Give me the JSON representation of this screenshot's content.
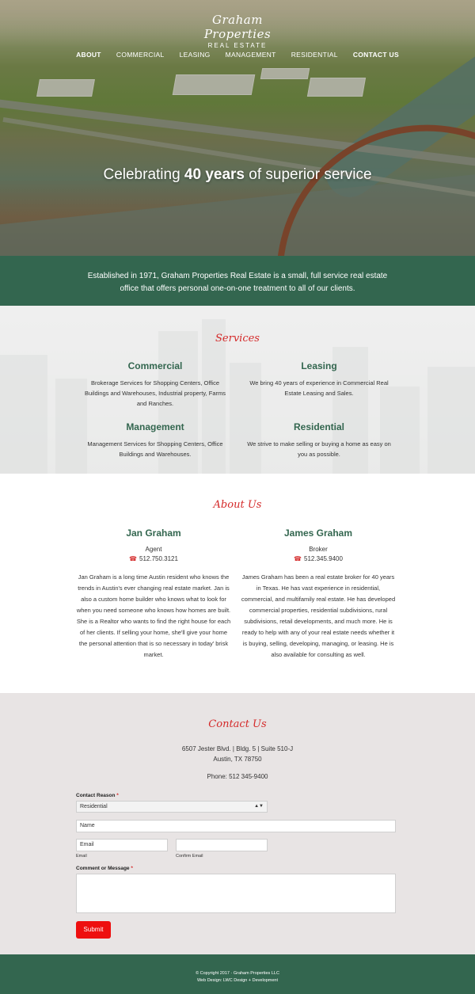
{
  "brand": {
    "logo_script": "Graham Properties",
    "logo_sub": "REAL ESTATE"
  },
  "nav": [
    {
      "label": "ABOUT",
      "bold": true
    },
    {
      "label": "COMMERCIAL",
      "bold": false
    },
    {
      "label": "LEASING",
      "bold": false
    },
    {
      "label": "MANAGEMENT",
      "bold": false
    },
    {
      "label": "RESIDENTIAL",
      "bold": false
    },
    {
      "label": "CONTACT US",
      "bold": true
    }
  ],
  "hero": {
    "prefix": "Celebrating ",
    "emphasis": "40 years",
    "suffix": " of superior service"
  },
  "intro": {
    "text": "Established in 1971, Graham Properties Real Estate is a small, full service real estate office that offers personal one-on-one treatment to all of our clients."
  },
  "services": {
    "title": "Services",
    "items": [
      {
        "name": "Commercial",
        "text": "Brokerage Services for Shopping Centers, Office Buildings and Warehouses, Industrial property, Farms and Ranches."
      },
      {
        "name": "Leasing",
        "text": "We bring 40 years of experience in Commercial Real Estate Leasing and Sales."
      },
      {
        "name": "Management",
        "text": "Management Services for Shopping Centers, Office Buildings and Warehouses."
      },
      {
        "name": "Residential",
        "text": "We strive to make selling or buying a home as easy on you as possible."
      }
    ]
  },
  "about": {
    "title": "About Us",
    "people": [
      {
        "name": "Jan Graham",
        "role": "Agent",
        "phone": "512.750.3121",
        "bio": "Jan Graham is a long time Austin resident who knows the trends in Austin's ever changing real estate market. Jan is also a custom home builder who knows what to look for when you need someone who knows how homes are built. She is a Realtor who wants to find the right house for each of her clients. If selling your home, she'll give your home the personal attention that is so necessary in today' brisk market."
      },
      {
        "name": "James Graham",
        "role": "Broker",
        "phone": "512.345.9400",
        "bio": "James Graham has been a real estate broker for 40 years in Texas. He has vast experience in residential, commercial, and multifamily real estate. He has developed commercial properties, residential subdivisions, rural subdivisions, retail developments, and much more. He is ready to help with any of your real estate needs whether it is buying, selling, developing, managing, or leasing. He is also available for consulting as well."
      }
    ]
  },
  "contact": {
    "title": "Contact Us",
    "address_line1": "6507 Jester Blvd. | Bldg. 5 | Suite 510-J",
    "address_line2": "Austin, TX 78750",
    "phone": "Phone: 512 345-9400",
    "reason_label": "Contact Reason",
    "reason_value": "Residential",
    "name_placeholder": "Name",
    "email_placeholder": "Email",
    "email_sublabel": "Email",
    "confirm_sublabel": "Confirm Email",
    "comment_label": "Comment or Message",
    "required_mark": "*",
    "submit_label": "Submit"
  },
  "footer": {
    "copyright": "© Copyright 2017 · Graham Properties LLC",
    "credit": "Web Design: LWC Design + Development"
  },
  "colors": {
    "green": "#33664f",
    "red": "#d42929",
    "button": "#ee0f0f",
    "contact_bg": "#e8e4e4"
  }
}
